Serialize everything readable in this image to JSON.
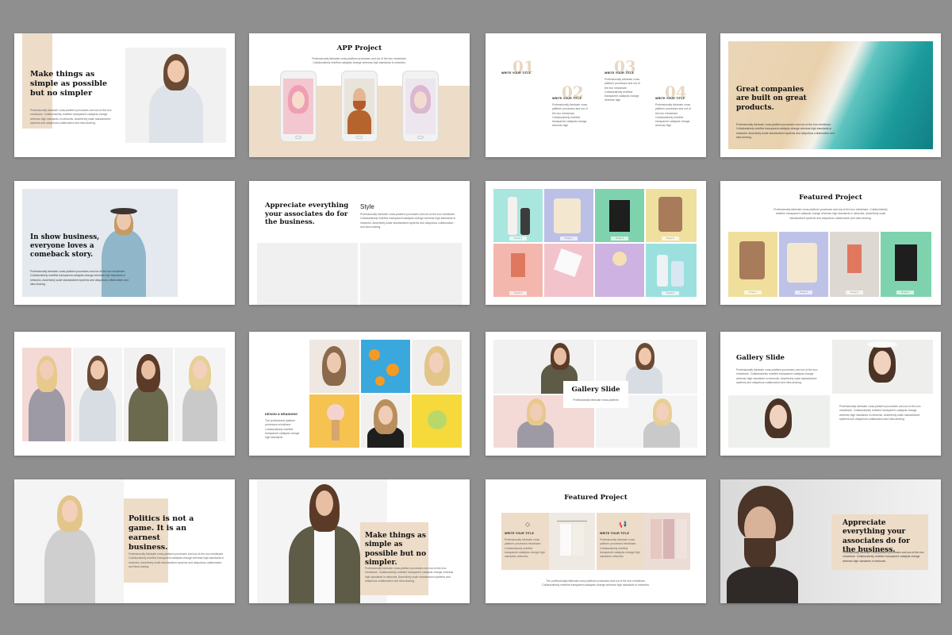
{
  "slides": {
    "s1": {
      "title": "Make things as simple as possible but no simpler",
      "text": "Professionally fabricate cross-platform processes and out-of-the-box mindshare. Collaboratively redefine transparent catalysts change whereas high standards in networks. Assertively scale standardized systems and ubiquitous collaboration and idea-sharing."
    },
    "s2": {
      "title": "APP Project",
      "text": "Professionally fabricate cross-platform processes and out of the box mindshare. Collaboratively redefine catalysts change whereas high standards in networks."
    },
    "s3": {
      "items": [
        {
          "num": "01",
          "label": "WRITE YOUR TITLE",
          "text": "Professionally fabricate cross platform processes and out of the box mindshare. Collaboratively redefine transparent catalysts change whereas high"
        },
        {
          "num": "02",
          "label": "WRITE YOUR TITLE",
          "text": "Professionally fabricate cross platform processes and out of the box mindshare. Collaboratively redefine transparent catalysts change whereas high"
        },
        {
          "num": "03",
          "label": "WRITE YOUR TITLE",
          "text": "Professionally fabricate cross platform processes and out of the box mindshare. Collaboratively redefine transparent catalysts change whereas high"
        },
        {
          "num": "04",
          "label": "WRITE YOUR TITLE",
          "text": "Professionally fabricate cross platform processes and out of the box mindshare. Collaboratively redefine transparent catalysts change whereas high"
        }
      ]
    },
    "s4": {
      "title": "Great companies are built on great products.",
      "text": "Professionally fabricate cross-platform processes and out-of-the-box mindshare. Collaboratively redefine transparent catalysts change whereas high standards in networks. Assertively scale standardized systems and ubiquitous collaboration and idea-sharing."
    },
    "s5": {
      "title": "In show business, everyone loves a comeback story.",
      "text": "Professionally fabricate cross-platform processes and out-of-the-box mindshare. Collaboratively redefine transparent catalysts change whereas high standards in networks. Assertively scale standardized systems and ubiquitous collaboration and idea-sharing."
    },
    "s6": {
      "title": "Appreciate everything your associates do for the business.",
      "subtitle": "Style",
      "text": "Professionally fabricate cross-platform processes and out-of-the-box mindshare. Collaboratively redefine transparent catalysts change whereas high standards in networks. Assertively scale standardized systems and ubiquitous collaboration and idea-sharing."
    },
    "s7": {
      "captions": [
        "Project 1",
        "Project 2",
        "Project 3",
        "Project 4",
        "Project 5",
        "Project 6",
        "Project 7",
        "Project 8"
      ]
    },
    "s8": {
      "title": "Featured Project",
      "text": "Professionally fabricate cross-platform processes and out-of-the-box mindshare. Collaboratively redefine transparent catalysts change whereas high standards in networks. Assertively scale standardized systems and ubiquitous collaboration and idea-sharing.",
      "captions": [
        "Project 1",
        "Project 2",
        "Project 3",
        "Project 4"
      ]
    },
    "s10": {
      "label": "DESIGN & BRANDING",
      "text": "The professional platform processes mindshare. Collaboratively redefine transparent catalysts change high standards"
    },
    "s11": {
      "title": "Gallery Slide",
      "text": "Professionally fabricate cross-platform"
    },
    "s12": {
      "title": "Gallery Slide",
      "text": "Professionally fabricate cross-platform processes and out-of-the-box mindshare. Collaboratively redefine transparent catalysts change whereas high standards in networks. Assertively scale standardized systems and ubiquitous collaboration and idea-sharing.",
      "text2": "Professionally fabricate cross-platform processes and out-of-the-box mindshare. Collaboratively redefine transparent catalysts change whereas high standards in networks. Assertively scale standardized systems and ubiquitous collaboration and idea-sharing."
    },
    "s13": {
      "title": "Politics is not a game. It is an earnest business.",
      "text": "Professionally fabricate cross-platform processes and out-of-the-box mindshare. Collaboratively redefine transparent catalysts change whereas high standards in networks. Assertively scale standardized systems and ubiquitous collaboration and idea-sharing."
    },
    "s14": {
      "title": "Make things as simple as possible but no simpler.",
      "text": "Professionally fabricate cross-platform processes and out-of-the-box mindshare. Collaboratively redefine transparent catalysts change whereas high standards in networks. Assertively scale standardized systems and ubiquitous collaboration and idea-sharing."
    },
    "s15": {
      "title": "Featured Project",
      "label1": "WRITE YOUR TITLE",
      "text1": "Professionally fabricate cross platform processes mindshare. Collaboratively redefine transparent catalysts change high standards networks.",
      "label2": "WRITE YOUR TITLE",
      "text2": "Professionally fabricate cross platform processes mindshare. Collaboratively redefine transparent catalysts change high standards networks.",
      "footer": "The professionally fabricate cross platform processes and out of the box mindshare. Collaboratively redefine transparent catalysts change whereas high standards in networks."
    },
    "s16": {
      "title": "Appreciate everything your associates do for the business.",
      "text": "Professionally fabricate cross-platform processes and out-of-the-box mindshare. Collaboratively redefine transparent catalysts change whereas high standards in networks."
    }
  }
}
